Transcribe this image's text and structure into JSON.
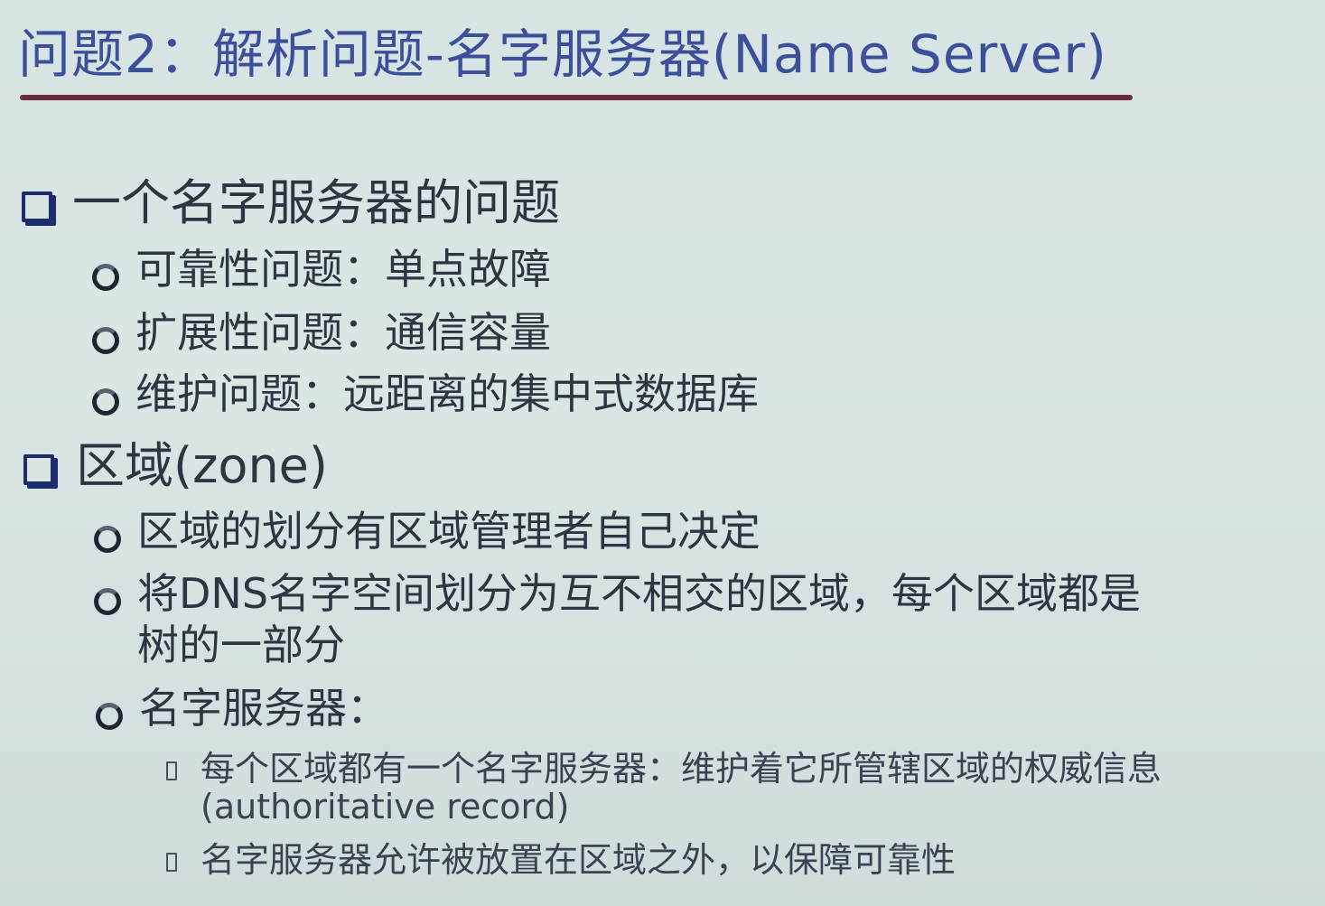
{
  "title": "问题2：解析问题-名字服务器(Name Server)",
  "sections": [
    {
      "heading": "一个名字服务器的问题",
      "items": [
        "可靠性问题：单点故障",
        "扩展性问题：通信容量",
        "维护问题：远距离的集中式数据库"
      ]
    },
    {
      "heading": "区域(zone)",
      "items": [
        "区域的划分有区域管理者自己决定",
        "将DNS名字空间划分为互不相交的区域，每个区域都是",
        "树的一部分",
        "名字服务器："
      ],
      "subitems": [
        "每个区域都有一个名字服务器：维护着它所管辖区域的权威信息",
        "(authoritative record)",
        "名字服务器允许被放置在区域之外，以保障可靠性"
      ]
    }
  ],
  "icons": {
    "level1": "square-checkbox-icon",
    "level2": "circle-bullet-icon",
    "level3": "small-square-bullet-icon"
  }
}
